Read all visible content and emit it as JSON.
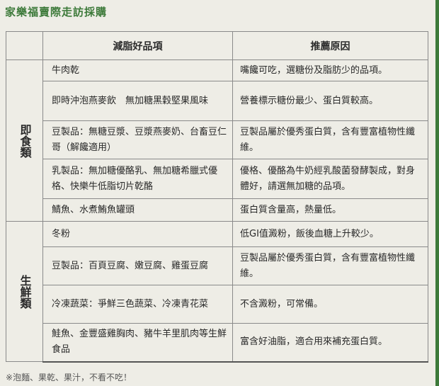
{
  "title": "家樂福賣際走訪採購",
  "header": {
    "item_col": "減脂好品項",
    "reason_col": "推薦原因"
  },
  "sections": [
    {
      "category": "即食類",
      "rows": [
        {
          "item": "牛肉乾",
          "reason": "嘴饞可吃，選糖份及脂肪少的品項。"
        },
        {
          "item": "即時沖泡燕麥飲　無加糖黑穀堅果風味",
          "reason": "營養標示糖份最少、蛋白質較高。"
        },
        {
          "item": "豆製品：無糖豆漿、豆漿燕麥奶、台畜豆仁哥（解饞適用）",
          "reason": "豆製品屬於優秀蛋白質，含有豐富植物性纖維。"
        },
        {
          "item": "乳製品：無加糖優酪乳、無加糖希臘式優格、快樂牛低脂切片乾酪",
          "reason": "優格、優酪為牛奶經乳酸菌發酵製成，對身體好，請選無加糖的品項。"
        },
        {
          "item": "鯖魚、水煮鮪魚罐頭",
          "reason": "蛋白質含量高，熱量低。"
        }
      ]
    },
    {
      "category": "生鮮類",
      "rows": [
        {
          "item": "冬粉",
          "reason": "低GI值澱粉，飯後血糖上升較少。"
        },
        {
          "item": "豆製品：百頁豆腐、嫩豆腐、雞蛋豆腐",
          "reason": "豆製品屬於優秀蛋白質，含有豐富植物性纖維。"
        },
        {
          "item": "冷凍蔬菜：爭鮮三色蔬菜、冷凍青花菜",
          "reason": "不含澱粉，可常備。"
        },
        {
          "item": "鮭魚、金豐盛雞胸肉、豬牛羊里肌肉等生鮮食品",
          "reason": "富含好油脂，適合用來補充蛋白質。"
        }
      ]
    }
  ],
  "footnote": "※泡麵、果乾、果汁，不看不吃！",
  "colors": {
    "accent": "#3d7a3a",
    "background": "#eeede6"
  }
}
